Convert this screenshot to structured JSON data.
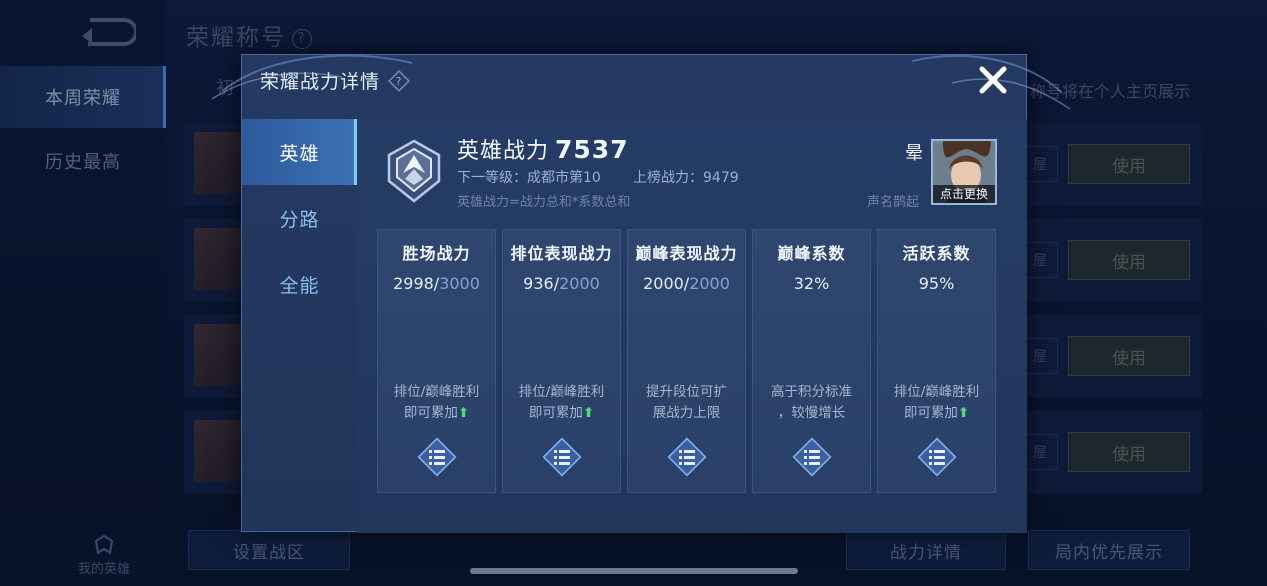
{
  "background": {
    "page_title": "荣耀称号",
    "sidebar": [
      {
        "label": "本周荣耀",
        "active": true
      },
      {
        "label": "历史最高",
        "active": false
      }
    ],
    "my_hero_label": "我的英雄",
    "first_tab_partial": "初",
    "hint_text": "称号将在个人主页展示",
    "row_use_label": "使用",
    "row_mini_label": "屋",
    "bottom_buttons": {
      "set_region": "设置战区",
      "power_detail": "战力详情",
      "priority_display": "局内优先展示"
    }
  },
  "modal": {
    "title": "荣耀战力详情",
    "help": "?",
    "tabs": [
      {
        "label": "英雄",
        "active": true
      },
      {
        "label": "分路",
        "active": false
      },
      {
        "label": "全能",
        "active": false
      }
    ],
    "hero_power_label": "英雄战力",
    "hero_power_value": "7537",
    "next_level": "下一等级：成都市第10",
    "rank_power": "上榜战力：9479",
    "formula": "英雄战力=战力总和*系数总和",
    "player_name": "晕",
    "player_title": "声名鹊起",
    "avatar_label": "点击更换",
    "cards": [
      {
        "title": "胜场战力",
        "value": "2998",
        "max": "3000",
        "desc1": "排位/巅峰胜利",
        "desc2": "即可累加",
        "arrow": true
      },
      {
        "title": "排位表现战力",
        "value": "936",
        "max": "2000",
        "desc1": "排位/巅峰胜利",
        "desc2": "即可累加",
        "arrow": true
      },
      {
        "title": "巅峰表现战力",
        "value": "2000",
        "max": "2000",
        "desc1": "提升段位可扩",
        "desc2": "展战力上限",
        "arrow": false
      },
      {
        "title": "巅峰系数",
        "value": "32%",
        "max": "",
        "desc1": "高于积分标准",
        "desc2": "，较慢增长",
        "arrow": false
      },
      {
        "title": "活跃系数",
        "value": "95%",
        "max": "",
        "desc1": "排位/巅峰胜利",
        "desc2": "即可累加",
        "arrow": true
      }
    ],
    "arrow_glyph": "⬆"
  },
  "colors": {
    "accent": "#3b72b6",
    "up_arrow": "#4ddc74",
    "max_value": "#7fa5d6"
  }
}
